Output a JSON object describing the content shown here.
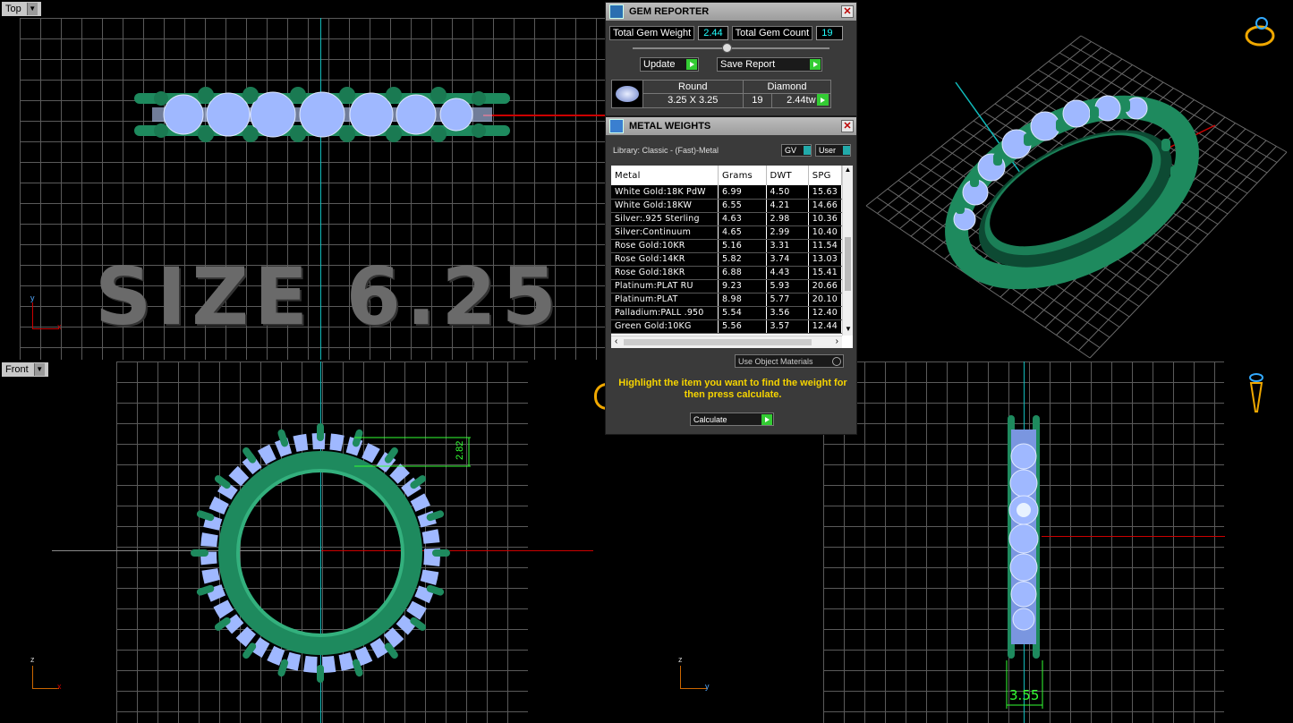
{
  "viewports": {
    "top": {
      "label": "Top",
      "overlay_text": "SIZE 6.25",
      "axis_x": "x",
      "axis_y": "y"
    },
    "front": {
      "label": "Front",
      "axis_x": "x",
      "axis_z": "z",
      "dimension": "2.82"
    },
    "right": {
      "axis_y": "y",
      "axis_z": "z",
      "dimension": "3.55"
    }
  },
  "gem_reporter": {
    "title": "GEM REPORTER",
    "total_weight_label": "Total Gem Weight",
    "total_weight_value": "2.44",
    "total_count_label": "Total Gem Count",
    "total_count_value": "19",
    "update_label": "Update",
    "save_report_label": "Save Report",
    "gem_shape": "Round",
    "gem_size": "3.25 X 3.25",
    "gem_material": "Diamond",
    "gem_count": "19",
    "gem_weight": "2.44tw"
  },
  "metal_weights": {
    "title": "METAL WEIGHTS",
    "library_label": "Library: Classic - (Fast)-Metal",
    "gv_label": "GV",
    "user_label": "User",
    "columns": [
      "Metal",
      "Grams",
      "DWT",
      "SPG"
    ],
    "rows": [
      [
        "White Gold:18K PdW",
        "6.99",
        "4.50",
        "15.63"
      ],
      [
        "White Gold:18KW",
        "6.55",
        "4.21",
        "14.66"
      ],
      [
        "Silver:.925 Sterling",
        "4.63",
        "2.98",
        "10.36"
      ],
      [
        "Silver:Continuum",
        "4.65",
        "2.99",
        "10.40"
      ],
      [
        "Rose Gold:10KR",
        "5.16",
        "3.31",
        "11.54"
      ],
      [
        "Rose Gold:14KR",
        "5.82",
        "3.74",
        "13.03"
      ],
      [
        "Rose Gold:18KR",
        "6.88",
        "4.43",
        "15.41"
      ],
      [
        "Platinum:PLAT RU",
        "9.23",
        "5.93",
        "20.66"
      ],
      [
        "Platinum:PLAT",
        "8.98",
        "5.77",
        "20.10"
      ],
      [
        "Palladium:PALL .950",
        "5.54",
        "3.56",
        "12.40"
      ],
      [
        "Green Gold:10KG",
        "5.56",
        "3.57",
        "12.44"
      ]
    ],
    "use_object_materials_label": "Use Object Materials",
    "hint": "Highlight the item you want to find the weight for then press calculate.",
    "calculate_label": "Calculate"
  },
  "colors": {
    "metal": "#1e8a5e",
    "gem": "#9fb8ff",
    "grid": "#5a5a5a",
    "accent_text": "#f6d400",
    "value_text": "#22ffff"
  },
  "icons": [
    "gem-reporter-icon",
    "metal-weights-icon",
    "ring-perspective-icon",
    "ring-side-icon",
    "close-icon",
    "scroll-arrow-icon"
  ]
}
